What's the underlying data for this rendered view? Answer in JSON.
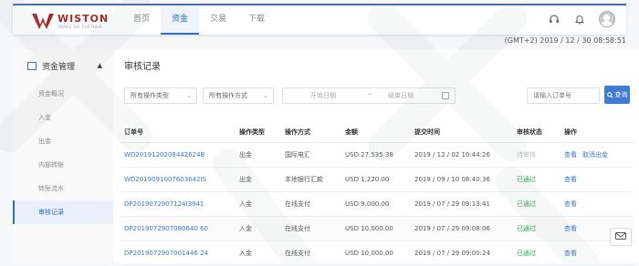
{
  "brand": {
    "name": "WISTON",
    "tagline": "TRADE GO FURTHER"
  },
  "nav": [
    "首页",
    "资金",
    "交易",
    "下载"
  ],
  "nav_active": 1,
  "datetime": "(GMT+2) 2019 / 12 / 30 08:58:51",
  "sidebar": {
    "section": "资金管理",
    "items": [
      "资金概况",
      "入金",
      "出金",
      "内部转账",
      "转账流水",
      "审核记录"
    ],
    "active": 5
  },
  "main": {
    "title": "审核记录",
    "filters": {
      "type_select": "所有操作类型",
      "method_select": "所有操作方式",
      "start_placeholder": "开始日期",
      "separator": "~",
      "end_placeholder": "结束日期",
      "order_placeholder": "请输入订单号",
      "search_label": "查询"
    },
    "columns": [
      "订单号",
      "操作类型",
      "操作方式",
      "金额",
      "提交时间",
      "审核状态",
      "操作"
    ],
    "rows": [
      {
        "order": "WD2019120208442624B",
        "type": "出金",
        "method": "国际电汇",
        "amount": "USD 27,535.38",
        "time": "2019 / 12 / 02 10:44:26",
        "status": "待审核",
        "actions": [
          "查看",
          "取消出金"
        ]
      },
      {
        "order": "WD2019091007603642IS",
        "type": "出金",
        "method": "本地银行汇款",
        "amount": "USD 1,220.00",
        "time": "2019 / 09 / 10 08:40:36",
        "status": "已通过",
        "actions": [
          "查看"
        ]
      },
      {
        "order": "DP2019072907124I3941",
        "type": "入金",
        "method": "在线支付",
        "amount": "USD 9,000.00",
        "time": "2019 / 07 / 29 09:13:41",
        "status": "已通过",
        "actions": [
          "查看"
        ]
      },
      {
        "order": "DP2019072907080640 60",
        "type": "入金",
        "method": "在线支付",
        "amount": "USD 10,000.00",
        "time": "2019 / 07 / 29 09:08:06",
        "status": "已通过",
        "actions": [
          "查看"
        ]
      },
      {
        "order": "DP2019072907001446 24",
        "type": "入金",
        "method": "在线支付",
        "amount": "USD 10,000.00",
        "time": "2019 / 07 / 29 09:00:24",
        "status": "已通过",
        "actions": [
          "查看"
        ]
      }
    ]
  },
  "colors": {
    "accent": "#2d6fc5",
    "brand": "#a32a2a",
    "success": "#2aa55a"
  }
}
